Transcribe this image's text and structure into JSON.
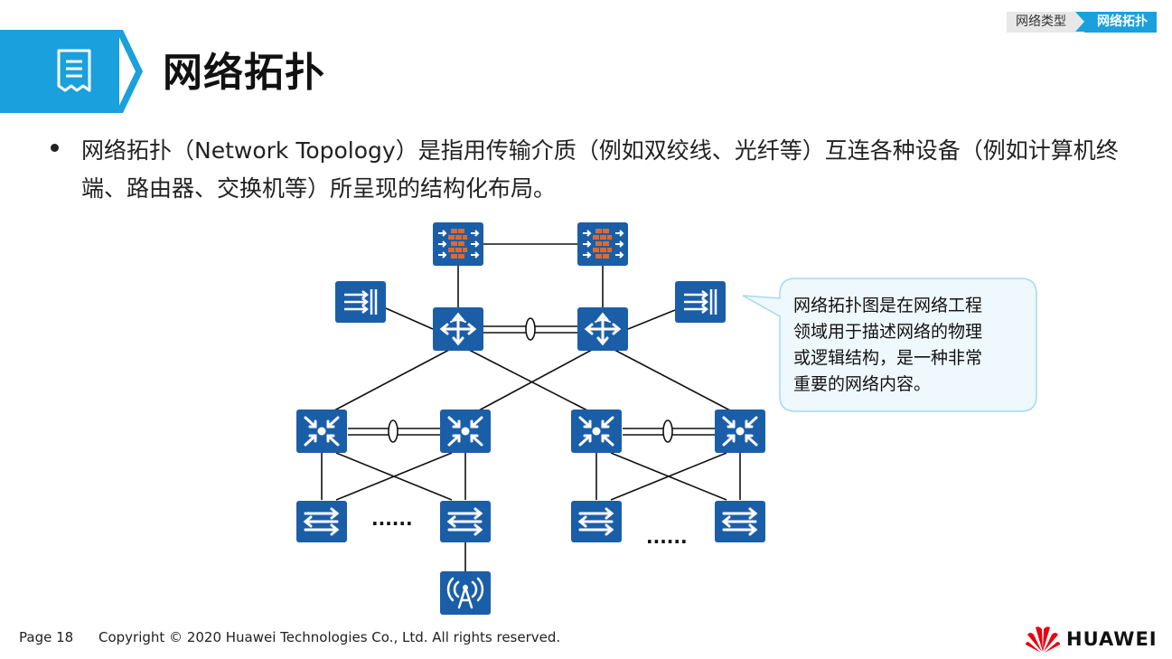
{
  "breadcrumb": {
    "items": [
      "网络类型",
      "网络拓扑"
    ]
  },
  "page": {
    "title": "网络拓扑"
  },
  "bullet": {
    "text": "网络拓扑（Network  Topology）是指用传输介质（例如双绞线、光纤等）互连各种设备（例如计算机终端、路由器、交换机等）所呈现的结构化布局。"
  },
  "callout": {
    "lines": [
      "网络拓扑图是在网络工程",
      "领域用于描述网络的物理",
      "或逻辑结构，是一种非常",
      "重要的网络内容。"
    ]
  },
  "diagram": {
    "ellipsis_left": "......",
    "ellipsis_right": "......",
    "device_color": "#1b5ea8",
    "firewall_brick_color": "#e0692b"
  },
  "footer": {
    "page": "Page 18",
    "copyright": "Copyright © 2020 Huawei Technologies  Co., Ltd. All rights reserved."
  },
  "logo": {
    "text": "HUAWEI",
    "color": "#e60012"
  },
  "colors": {
    "accent": "#19a0dd",
    "callout_border": "#a8d8ef",
    "callout_bg": "#eef8fd"
  }
}
